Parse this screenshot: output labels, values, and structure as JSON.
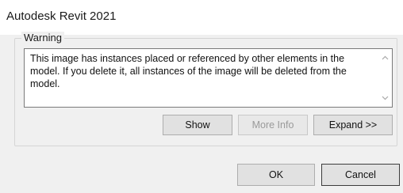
{
  "window": {
    "title": "Autodesk Revit 2021"
  },
  "warning": {
    "group_label": "Warning",
    "message": "This image has instances placed or referenced by other elements in the model. If you delete it, all instances of the image will be deleted from the model."
  },
  "actions": {
    "show_label": "Show",
    "more_info_label": "More Info",
    "expand_label": "Expand >>"
  },
  "footer": {
    "ok_label": "OK",
    "cancel_label": "Cancel"
  },
  "icons": {
    "scroll_up": "chevron-up-icon",
    "scroll_down": "chevron-down-icon"
  }
}
